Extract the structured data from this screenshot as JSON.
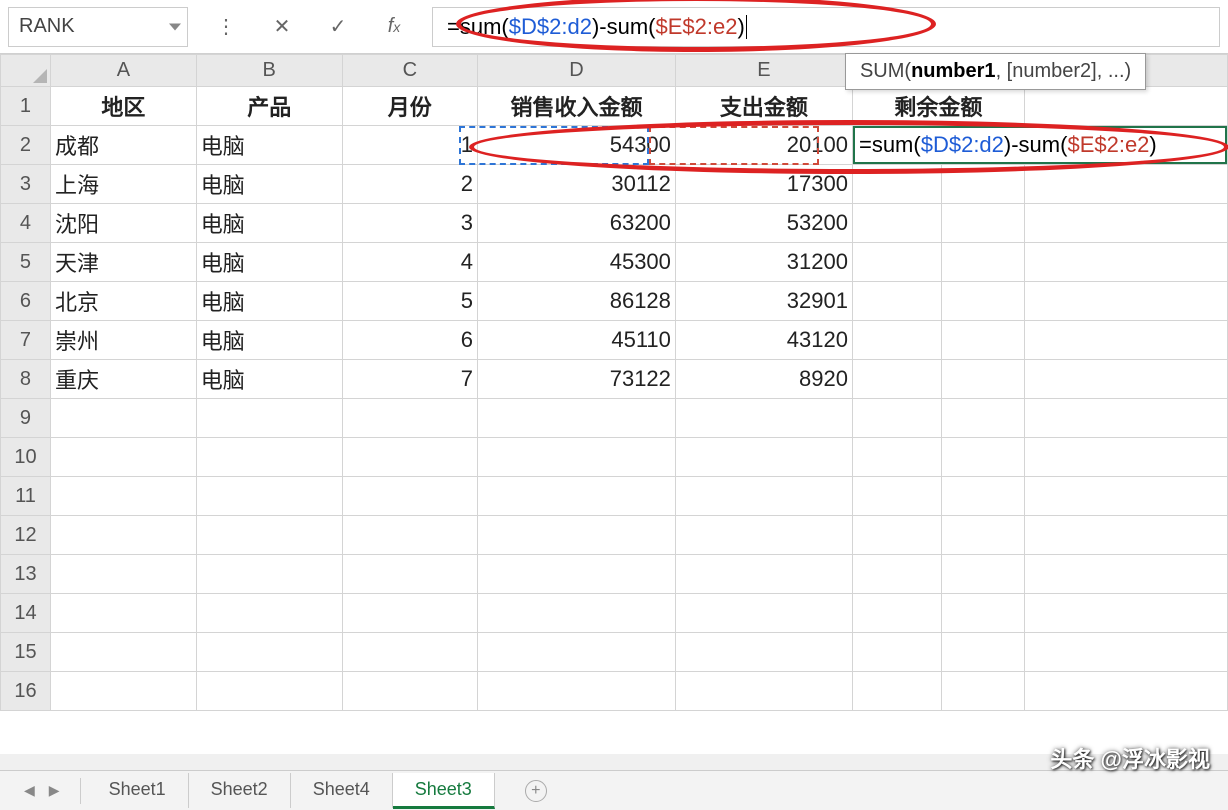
{
  "nameBox": "RANK",
  "formula": {
    "raw": "=sum($D$2:d2)-sum($E$2:e2)",
    "parts": [
      {
        "t": "=sum(",
        "c": "#000"
      },
      {
        "t": "$D$2:d2",
        "c": "#1e5cd6"
      },
      {
        "t": ")-sum(",
        "c": "#000"
      },
      {
        "t": "$E$2:e2",
        "c": "#c0392b"
      },
      {
        "t": ")",
        "c": "#000"
      }
    ]
  },
  "tooltip": {
    "fn": "SUM",
    "arg1": "number1",
    "rest": ", [number2], ...)"
  },
  "columns": [
    "A",
    "B",
    "C",
    "D",
    "E",
    "F",
    "G",
    "H"
  ],
  "headers": {
    "A": "地区",
    "B": "产品",
    "C": "月份",
    "D": "销售收入金额",
    "E": "支出金额",
    "F": "剩余金额"
  },
  "rows": [
    {
      "A": "成都",
      "B": "电脑",
      "C": "1",
      "D": "54300",
      "E": "20100"
    },
    {
      "A": "上海",
      "B": "电脑",
      "C": "2",
      "D": "30112",
      "E": "17300"
    },
    {
      "A": "沈阳",
      "B": "电脑",
      "C": "3",
      "D": "63200",
      "E": "53200"
    },
    {
      "A": "天津",
      "B": "电脑",
      "C": "4",
      "D": "45300",
      "E": "31200"
    },
    {
      "A": "北京",
      "B": "电脑",
      "C": "5",
      "D": "86128",
      "E": "32901"
    },
    {
      "A": "崇州",
      "B": "电脑",
      "C": "6",
      "D": "45110",
      "E": "43120"
    },
    {
      "A": "重庆",
      "B": "电脑",
      "C": "7",
      "D": "73122",
      "E": "8920"
    }
  ],
  "blankRows": [
    9,
    10,
    11,
    12,
    13,
    14,
    15,
    16
  ],
  "tabs": [
    "Sheet1",
    "Sheet2",
    "Sheet4",
    "Sheet3"
  ],
  "activeTab": "Sheet3",
  "watermark": "头条 @浮冰影视"
}
